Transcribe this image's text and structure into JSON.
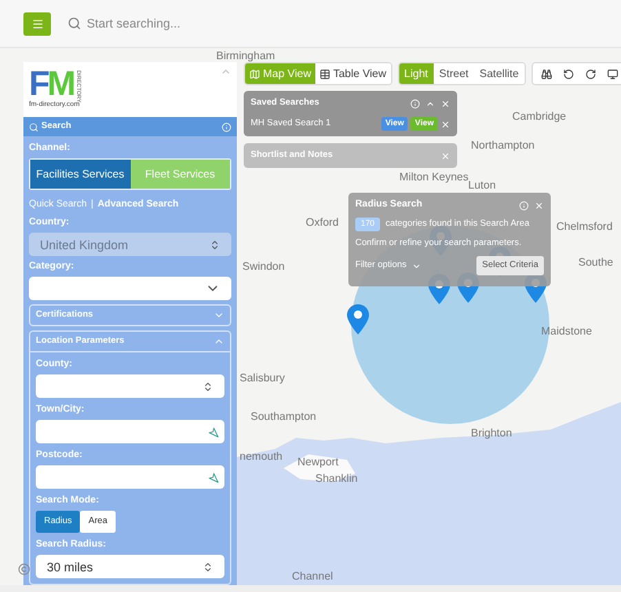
{
  "top_bar": {
    "search": {
      "placeholder": "Start searching..."
    }
  },
  "map": {
    "labels": [
      "Birmingham",
      "Northampton",
      "Cambridge",
      "Milton Keynes",
      "Luton",
      "Oxford",
      "Chelmsford",
      "Southe",
      "Swindon",
      "Maidstone",
      "Salisbury",
      "Southampton",
      "Brighton",
      "nemouth",
      "Newport",
      "Shanklin",
      "Channel"
    ]
  },
  "view_toggle": [
    {
      "label": "Map View",
      "selected": true
    },
    {
      "label": "Table View",
      "selected": false
    }
  ],
  "style_toggle": [
    {
      "label": "Light",
      "selected": true
    },
    {
      "label": "Street",
      "selected": false
    },
    {
      "label": "Satellite",
      "selected": false
    }
  ],
  "saved_searches": {
    "title": "Saved Searches",
    "items": [
      {
        "name": "MH Saved Search 1",
        "actions": [
          {
            "label": "View",
            "color": "#4a90e2"
          },
          {
            "label": "View",
            "color": "#6cbb2e"
          }
        ]
      }
    ]
  },
  "shortlist": {
    "title": "Shortlist and Notes"
  },
  "radius_popup": {
    "title": "Radius Search",
    "count": "170",
    "found_text": "categories found in this Search Area",
    "hint": "Confirm or refine your search parameters.",
    "filter": "Filter options",
    "button": "Select Criteria"
  },
  "sidebar": {
    "logo_caption": "fm-directory.com",
    "logo_letters": "FM",
    "logo_side": "DIRECTORY",
    "header": "Search",
    "channel_label": "Channel:",
    "channels": [
      {
        "label": "Facilities Services",
        "selected": true
      },
      {
        "label": "Fleet Services",
        "selected": false
      }
    ],
    "search_links": [
      {
        "label": "Quick Search",
        "selected": false
      },
      {
        "label": "Advanced Search",
        "selected": true
      }
    ],
    "separator": "|",
    "country": {
      "label": "Country:",
      "value": "United Kingdom",
      "disabled": true
    },
    "category": {
      "label": "Category:"
    },
    "sections": [
      {
        "title": "Certifications",
        "expanded": false
      },
      {
        "title": "Location Parameters",
        "expanded": true
      }
    ],
    "county": {
      "label": "County:"
    },
    "town": {
      "label": "Town/City:"
    },
    "postcode": {
      "label": "Postcode:"
    },
    "search_mode": {
      "label": "Search Mode:",
      "options": [
        {
          "label": "Radius",
          "selected": true
        },
        {
          "label": "Area",
          "selected": false
        }
      ]
    },
    "search_radius": {
      "label": "Search Radius:",
      "value": "30 miles"
    }
  }
}
